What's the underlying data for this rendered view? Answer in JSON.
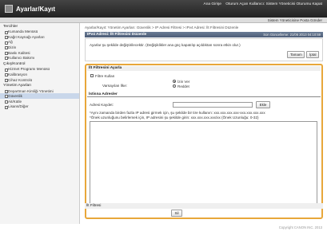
{
  "header": {
    "app_title": "Ayarlar/Kayıt",
    "links": [
      "Ana Girişe",
      "Oturum Açan Kullanıcı: Sistem Yöneticisi Oturumu Kapat"
    ],
    "sub_right": "Sistem Yöneticisine Posta Gönder"
  },
  "sidebar": {
    "groups": [
      {
        "title": "Tercihler",
        "items": [
          "Kumanda Menüsü",
          "Kağıt Kaynağı Ayarları",
          "Ağ",
          "Dizin",
          "Baskı Kalitesi",
          "Kullanıcı Bakımı"
        ]
      },
      {
        "title": "Çıkış/Kontrol",
        "items": [
          "Hizmet Programı Menüsü",
          "Kalibrasyon",
          "Cihaz Kontrolü"
        ]
      },
      {
        "title": "Yönetim Ayarları",
        "items": [
          "Departman Kimliği Yönetimi",
          "Güvenlik",
          "Ait/Kütle",
          "Lisans/Diğer"
        ]
      }
    ]
  },
  "main": {
    "breadcrumb": "Ayarlar/Kayıt: Yönetim Ayarları: Güvenlik > IP Adresi Filtresi > IPv4 Adresi: İlt Filtresini Düzenle",
    "title": "IPv4 Adresi: İlt Filtresini Düzenle",
    "timestamp": "Son Güncelleme: 21/06 2013 04:10:59",
    "info_message": "Ayarlar şu şekilde değiştirilecektir. (Değişiklikler ana güç kapatılıp açıldıktan sonra etkin olur.)",
    "ok_button": "Tamam",
    "cancel_button": "İptal",
    "section1_title": "İlt Filtresini Ayarla",
    "filter_label": "Filtre Kullan",
    "policy_label": "Varsayılan İlke:",
    "policy_options": [
      "İzin Ver",
      "Reddet"
    ],
    "policy_selected": "İzin Ver",
    "section2_title": "İstisna Adresler",
    "address_label": "Adresi Kaydet:",
    "address_value": "",
    "add_button": "Ekle",
    "note_1": "*Aynı zamanda birden fazla IP adresi girmek için, şu şekilde bir tire kullanın: xxx.xxx.xxx.xxx-xxx.xxx.xxx.xxx",
    "note_2": "*Önek uzunluğunu belirlemek için, IP adresini şu şekilde girin: xxx.xxx.xxx.xxx/xx (Önek Uzunluğu: 0-32)",
    "delete_button": "Sil",
    "section3_title": "İlt Filtresi"
  },
  "footer": {
    "copyright": "Copyright CANON INC. 2013"
  },
  "colors": {
    "header_bg": "#333333",
    "title_bar": "#5a6b86",
    "panel_border": "#e8a73a",
    "active_item": "#c9d7ea"
  }
}
